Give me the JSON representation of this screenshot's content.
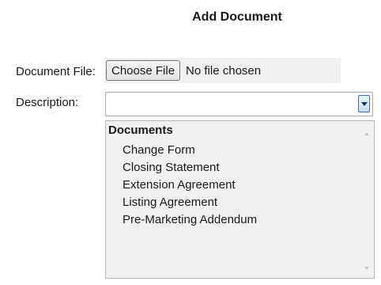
{
  "form": {
    "title": "Add Document",
    "file_label": "Document File:",
    "file_button_label": "Choose File",
    "file_status": "No file chosen",
    "description_label": "Description:",
    "description_value": ""
  },
  "dropdown": {
    "group_label": "Documents",
    "options": [
      "Change Form",
      "Closing Statement",
      "Extension Agreement",
      "Listing Agreement",
      "Pre-Marketing Addendum"
    ]
  },
  "icons": {
    "select_arrow": "chevron-down-icon",
    "scroll_up": "scroll-up-arrow-icon",
    "scroll_down": "scroll-down-arrow-icon"
  },
  "colors": {
    "arrow_border": "#3b6fb6",
    "dropdown_bg": "#f0f0f0"
  }
}
